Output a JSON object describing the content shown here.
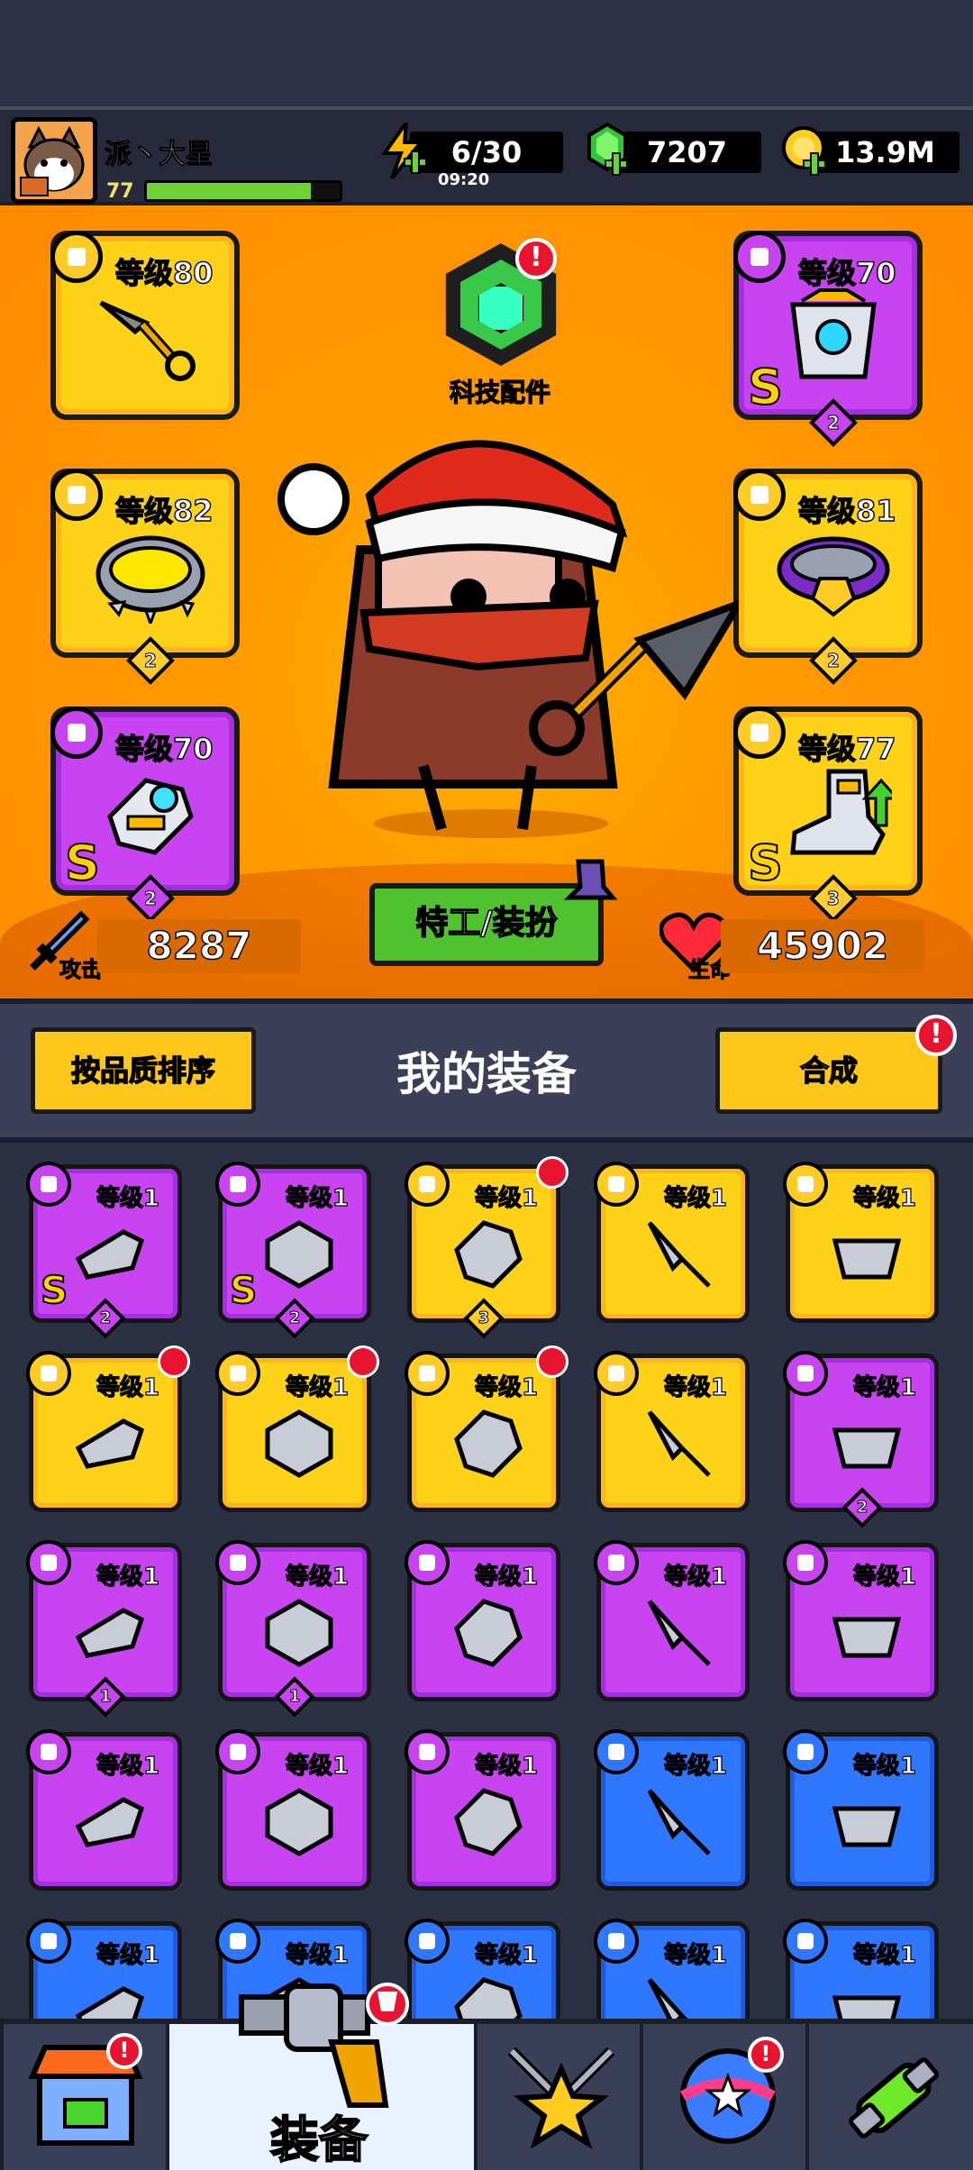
{
  "player": {
    "name": "派丶大星",
    "level": "77",
    "xp_fraction": 0.85
  },
  "resources": {
    "energy": "6/30",
    "energy_timer": "09:20",
    "gems": "7207",
    "coins": "13.9M"
  },
  "equipped": {
    "weapon_level": "等级80",
    "armor_level": "等级70",
    "armor_rank": "2",
    "necklace_level": "等级82",
    "necklace_rank": "2",
    "belt_level": "等级81",
    "belt_rank": "2",
    "glove_level": "等级70",
    "glove_rank": "2",
    "boots_level": "等级77",
    "boots_rank": "3",
    "s_mark": "S"
  },
  "tech": {
    "label": "科技配件",
    "alert": "!"
  },
  "hero": {
    "agent_button": "特工/装扮",
    "attack_label": "攻击",
    "attack_value": "8287",
    "hp_label": "生命",
    "hp_value": "45902"
  },
  "section": {
    "sort_button": "按品质排序",
    "title": "我的装备",
    "merge_button": "合成",
    "merge_alert": "!"
  },
  "inventory": {
    "level_text": "等级1",
    "items": [
      {
        "rarity": "purple",
        "s": true,
        "rank": "2",
        "red": false
      },
      {
        "rarity": "purple",
        "s": true,
        "rank": "2",
        "red": false
      },
      {
        "rarity": "yellow",
        "s": false,
        "rank": "3",
        "red": true
      },
      {
        "rarity": "yellow",
        "s": false,
        "rank": "",
        "red": false
      },
      {
        "rarity": "yellow",
        "s": false,
        "rank": "",
        "red": false
      },
      {
        "rarity": "yellow",
        "s": false,
        "rank": "",
        "red": true
      },
      {
        "rarity": "yellow",
        "s": false,
        "rank": "",
        "red": true
      },
      {
        "rarity": "yellow",
        "s": false,
        "rank": "",
        "red": true
      },
      {
        "rarity": "yellow",
        "s": false,
        "rank": "",
        "red": false
      },
      {
        "rarity": "purple",
        "s": false,
        "rank": "2",
        "red": false
      },
      {
        "rarity": "purple",
        "s": false,
        "rank": "1",
        "red": false
      },
      {
        "rarity": "purple",
        "s": false,
        "rank": "1",
        "red": false
      },
      {
        "rarity": "purple",
        "s": false,
        "rank": "",
        "red": false
      },
      {
        "rarity": "purple",
        "s": false,
        "rank": "",
        "red": false
      },
      {
        "rarity": "purple",
        "s": false,
        "rank": "",
        "red": false
      },
      {
        "rarity": "purple",
        "s": false,
        "rank": "",
        "red": false
      },
      {
        "rarity": "purple",
        "s": false,
        "rank": "",
        "red": false
      },
      {
        "rarity": "purple",
        "s": false,
        "rank": "",
        "red": false
      },
      {
        "rarity": "blue",
        "s": false,
        "rank": "",
        "red": false
      },
      {
        "rarity": "blue",
        "s": false,
        "rank": "",
        "red": false
      },
      {
        "rarity": "blue",
        "s": false,
        "rank": "",
        "red": false
      },
      {
        "rarity": "blue",
        "s": false,
        "rank": "",
        "red": false
      },
      {
        "rarity": "blue",
        "s": false,
        "rank": "",
        "red": false
      },
      {
        "rarity": "blue",
        "s": false,
        "rank": "",
        "red": false
      },
      {
        "rarity": "blue",
        "s": false,
        "rank": "",
        "red": false
      }
    ]
  },
  "bottom_nav": {
    "active_label": "装备"
  }
}
